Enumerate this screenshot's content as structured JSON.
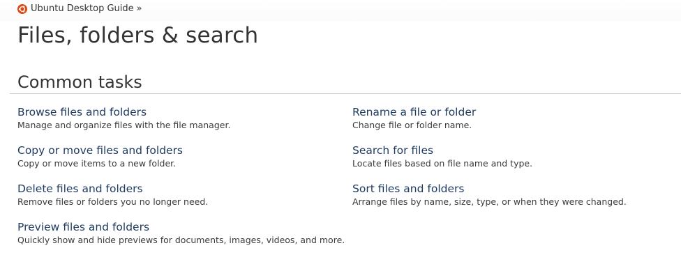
{
  "breadcrumb": {
    "logo_icon": "ubuntu-logo-icon",
    "label": "Ubuntu Desktop Guide",
    "separator": "»"
  },
  "page": {
    "title": "Files, folders & search"
  },
  "section": {
    "title": "Common tasks"
  },
  "tasks_left": [
    {
      "title": "Browse files and folders",
      "desc": "Manage and organize files with the file manager."
    },
    {
      "title": "Copy or move files and folders",
      "desc": "Copy or move items to a new folder."
    },
    {
      "title": "Delete files and folders",
      "desc": "Remove files or folders you no longer need."
    },
    {
      "title": "Preview files and folders",
      "desc": "Quickly show and hide previews for documents, images, videos, and more."
    }
  ],
  "tasks_right": [
    {
      "title": "Rename a file or folder",
      "desc": "Change file or folder name."
    },
    {
      "title": "Search for files",
      "desc": "Locate files based on file name and type."
    },
    {
      "title": "Sort files and folders",
      "desc": "Arrange files by name, size, type, or when they were changed."
    }
  ],
  "colors": {
    "link": "#1e3a5f",
    "text": "#333333",
    "ubuntu_orange": "#dd4814"
  }
}
